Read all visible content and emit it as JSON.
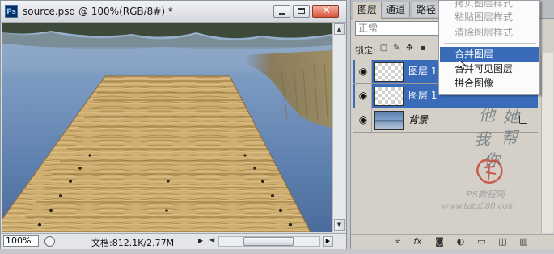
{
  "document": {
    "app_icon": "Ps",
    "title": "source.psd @ 100%(RGB/8#) *",
    "window_buttons": [
      "minimize-icon",
      "maximize-icon",
      "close-icon"
    ],
    "status": {
      "zoom": "100%",
      "doc_info": "文档:812.1K/2.77M"
    }
  },
  "panel": {
    "tabs": [
      "图层",
      "通道",
      "路径"
    ],
    "blend_mode": "正常",
    "lock_label": "锁定:",
    "layers": [
      {
        "name": "图层 1 副",
        "selected": true,
        "visible": true
      },
      {
        "name": "图层 1",
        "selected": true,
        "visible": true
      },
      {
        "name": "背景",
        "selected": false,
        "visible": true,
        "locked": true
      }
    ],
    "watermark": {
      "chars": [
        "他",
        "她",
        "我",
        "帮",
        "你"
      ],
      "seal_text": "PS教程网",
      "site": "www.tata580.com"
    },
    "bottom_icons": [
      "link-icon",
      "fx-icon",
      "mask-icon",
      "adjustment-icon",
      "folder-icon",
      "new-layer-icon",
      "trash-icon"
    ]
  },
  "context_menu": {
    "items": [
      {
        "label": "拷贝图层样式",
        "enabled": false
      },
      {
        "label": "粘贴图层样式",
        "enabled": false
      },
      {
        "label": "清除图层样式",
        "enabled": false
      },
      {
        "label": "合并图层",
        "enabled": true,
        "highlighted": true
      },
      {
        "label": "合并可见图层",
        "enabled": true
      },
      {
        "label": "拼合图像",
        "enabled": true
      }
    ]
  },
  "colors": {
    "selection": "#3a6bb8",
    "water": "#6e8fb6",
    "wood": "#c9a86a"
  }
}
